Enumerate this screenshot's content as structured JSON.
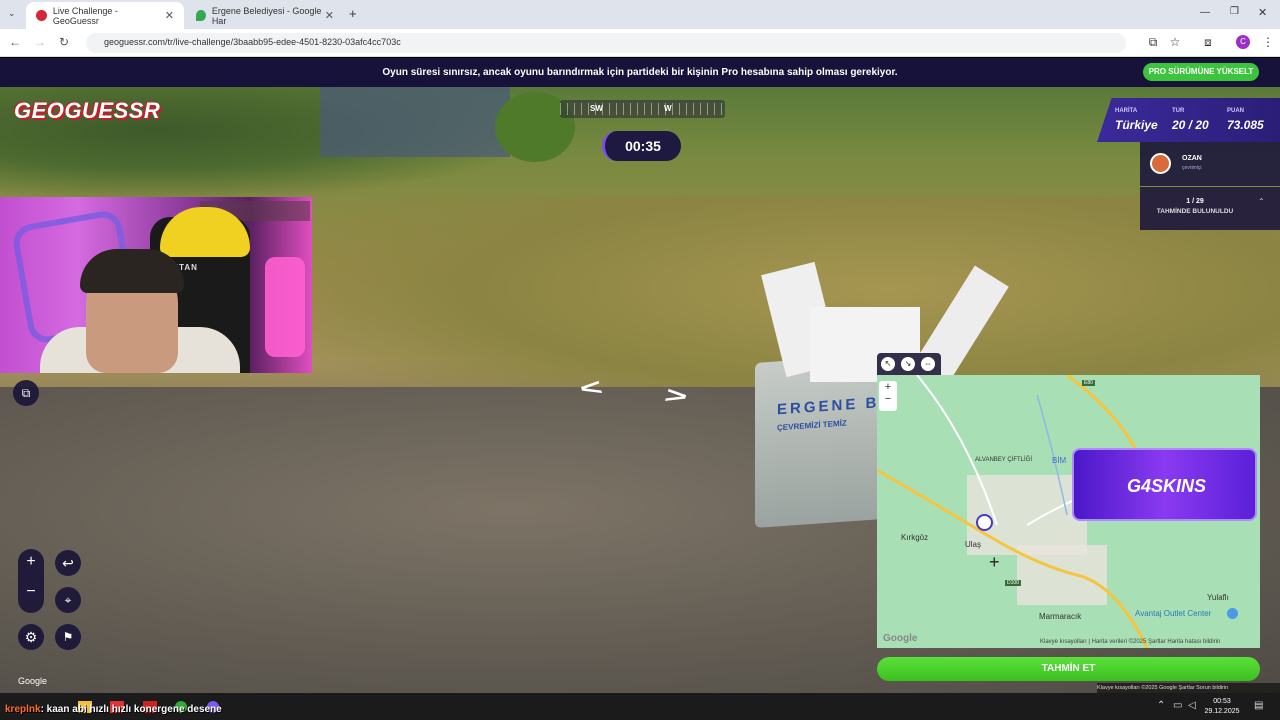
{
  "browser": {
    "tabs": [
      {
        "label": "Live Challenge - GeoGuessr",
        "active": true
      },
      {
        "label": "Ergene Belediyesi - Google Har",
        "active": false
      }
    ],
    "url": "geoguessr.com/tr/live-challenge/3baabb95-edee-4501-8230-03afc4cc703c",
    "profile_initial": "C"
  },
  "banner": {
    "text": "Oyun süresi sınırsız, ancak oyunu barındırmak için partideki bir kişinin Pro hesabına sahip olması gerekiyor.",
    "button": "PRO SÜRÜMÜNE YÜKSELT"
  },
  "game": {
    "logo": "GEOGUESSR",
    "compass": {
      "sw": "SW",
      "w": "W"
    },
    "timer": "00:35",
    "score": {
      "map_label": "HARİTA",
      "map_value": "Türkiye",
      "round_label": "TUR",
      "round_value": "20 / 20",
      "points_label": "PUAN",
      "points_value": "73.085"
    },
    "player": {
      "name": "OZAN",
      "status": "çevrimiçi"
    },
    "guesses": {
      "count": "1 / 29",
      "label": "TAHMİNDE BULUNULDU"
    },
    "scene_text": {
      "bin_brand": "ERGENE B",
      "bin_line2": "ÇEVREMİZİ TEMİZ"
    },
    "guess_button": "TAHMİN ET",
    "google_mark": "Google"
  },
  "map": {
    "labels": {
      "alvanbey": "ALVANBEY ÇİFTLİĞİ",
      "bim": "BİM",
      "kirkgoz": "Kırkgöz",
      "ulas": "Ulaş",
      "d100": "D100",
      "e80": "E80",
      "yulafli": "Yulaflı",
      "marmaracik": "Marmaracık",
      "avantaj": "Avantaj Outlet Center",
      "google": "Google"
    },
    "attribution": "Klavye kısayolları  |  Harita verileri ©2025   Şartlar   Harita hatası bildirin",
    "ad_text": "G4SKINS"
  },
  "footer": {
    "attribution": "Klavye kısayolları  ©2025 Google  Şartlar  Sorun bildirin",
    "chat_user": "kreplnk",
    "chat_message": ": kaan abi hızlı hızlı konergene desene",
    "time": "00:53",
    "date": "29.12.2025"
  },
  "colors": {
    "accent": "#7b4df0",
    "guess_green": "#3cc020",
    "banner_bg": "#16123a",
    "panel_bg": "#2a1e78"
  },
  "icons": [
    "search-icon",
    "street-view-icon",
    "compass-icon",
    "settings-icon",
    "flag-icon",
    "pin-icon",
    "undo-icon"
  ]
}
